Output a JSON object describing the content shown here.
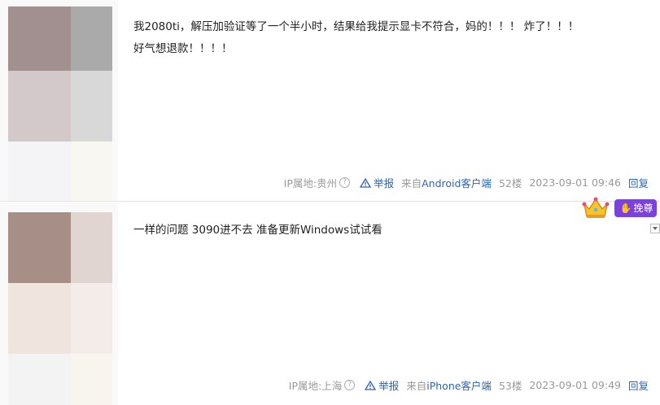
{
  "posts": [
    {
      "content": "我2080ti，解压加验证等了一个半小时，结果给我提示显卡不符合，妈的！！！ 炸了！！！\n好气想退款！！！！",
      "avatar_colors": [
        "#a28f8f",
        "#aaaaab",
        "#d3c9ca",
        "#d8d8d8",
        "#f4f4f6",
        "#f9f7f2"
      ],
      "ip_label": "IP属地:贵州",
      "info_glyph": "?",
      "report_label": "举报",
      "client_prefix": "来自",
      "client_label": "Android客户端",
      "floor": "52楼",
      "time": "2023-09-01 09:46",
      "reply_label": "回复"
    },
    {
      "content": "一样的问题 3090进不去 准备更新Windows试试看",
      "avatar_colors": [
        "#a78e87",
        "#e1d5d1",
        "#f0e4df",
        "#f4ece8",
        "#f3f3f3",
        "#f7f5ed"
      ],
      "ip_label": "IP属地:上海",
      "info_glyph": "?",
      "report_label": "举报",
      "client_prefix": "来自",
      "client_label": "iPhone客户端",
      "floor": "53楼",
      "time": "2023-09-01 09:49",
      "reply_label": "回复"
    }
  ],
  "badge": {
    "icon": "crown-icon",
    "label": "挽尊",
    "color": "#7b3fe4"
  }
}
